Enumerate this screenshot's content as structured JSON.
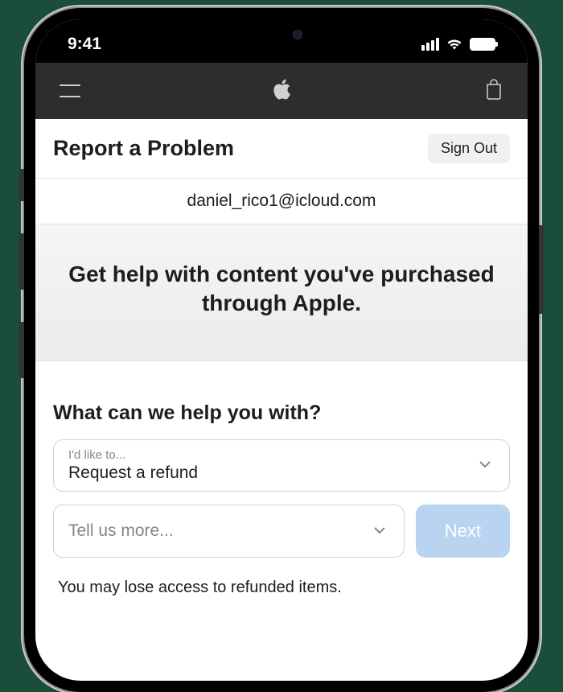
{
  "status_bar": {
    "time": "9:41"
  },
  "nav": {},
  "header": {
    "title": "Report a Problem",
    "signout_label": "Sign Out"
  },
  "account": {
    "email": "daniel_rico1@icloud.com"
  },
  "hero": {
    "text": "Get help with content you've purchased through Apple."
  },
  "form": {
    "heading": "What can we help you with?",
    "dropdown1": {
      "label": "I'd like to...",
      "value": "Request a refund"
    },
    "dropdown2": {
      "placeholder": "Tell us more..."
    },
    "next_label": "Next",
    "disclaimer": "You may lose access to refunded items."
  }
}
